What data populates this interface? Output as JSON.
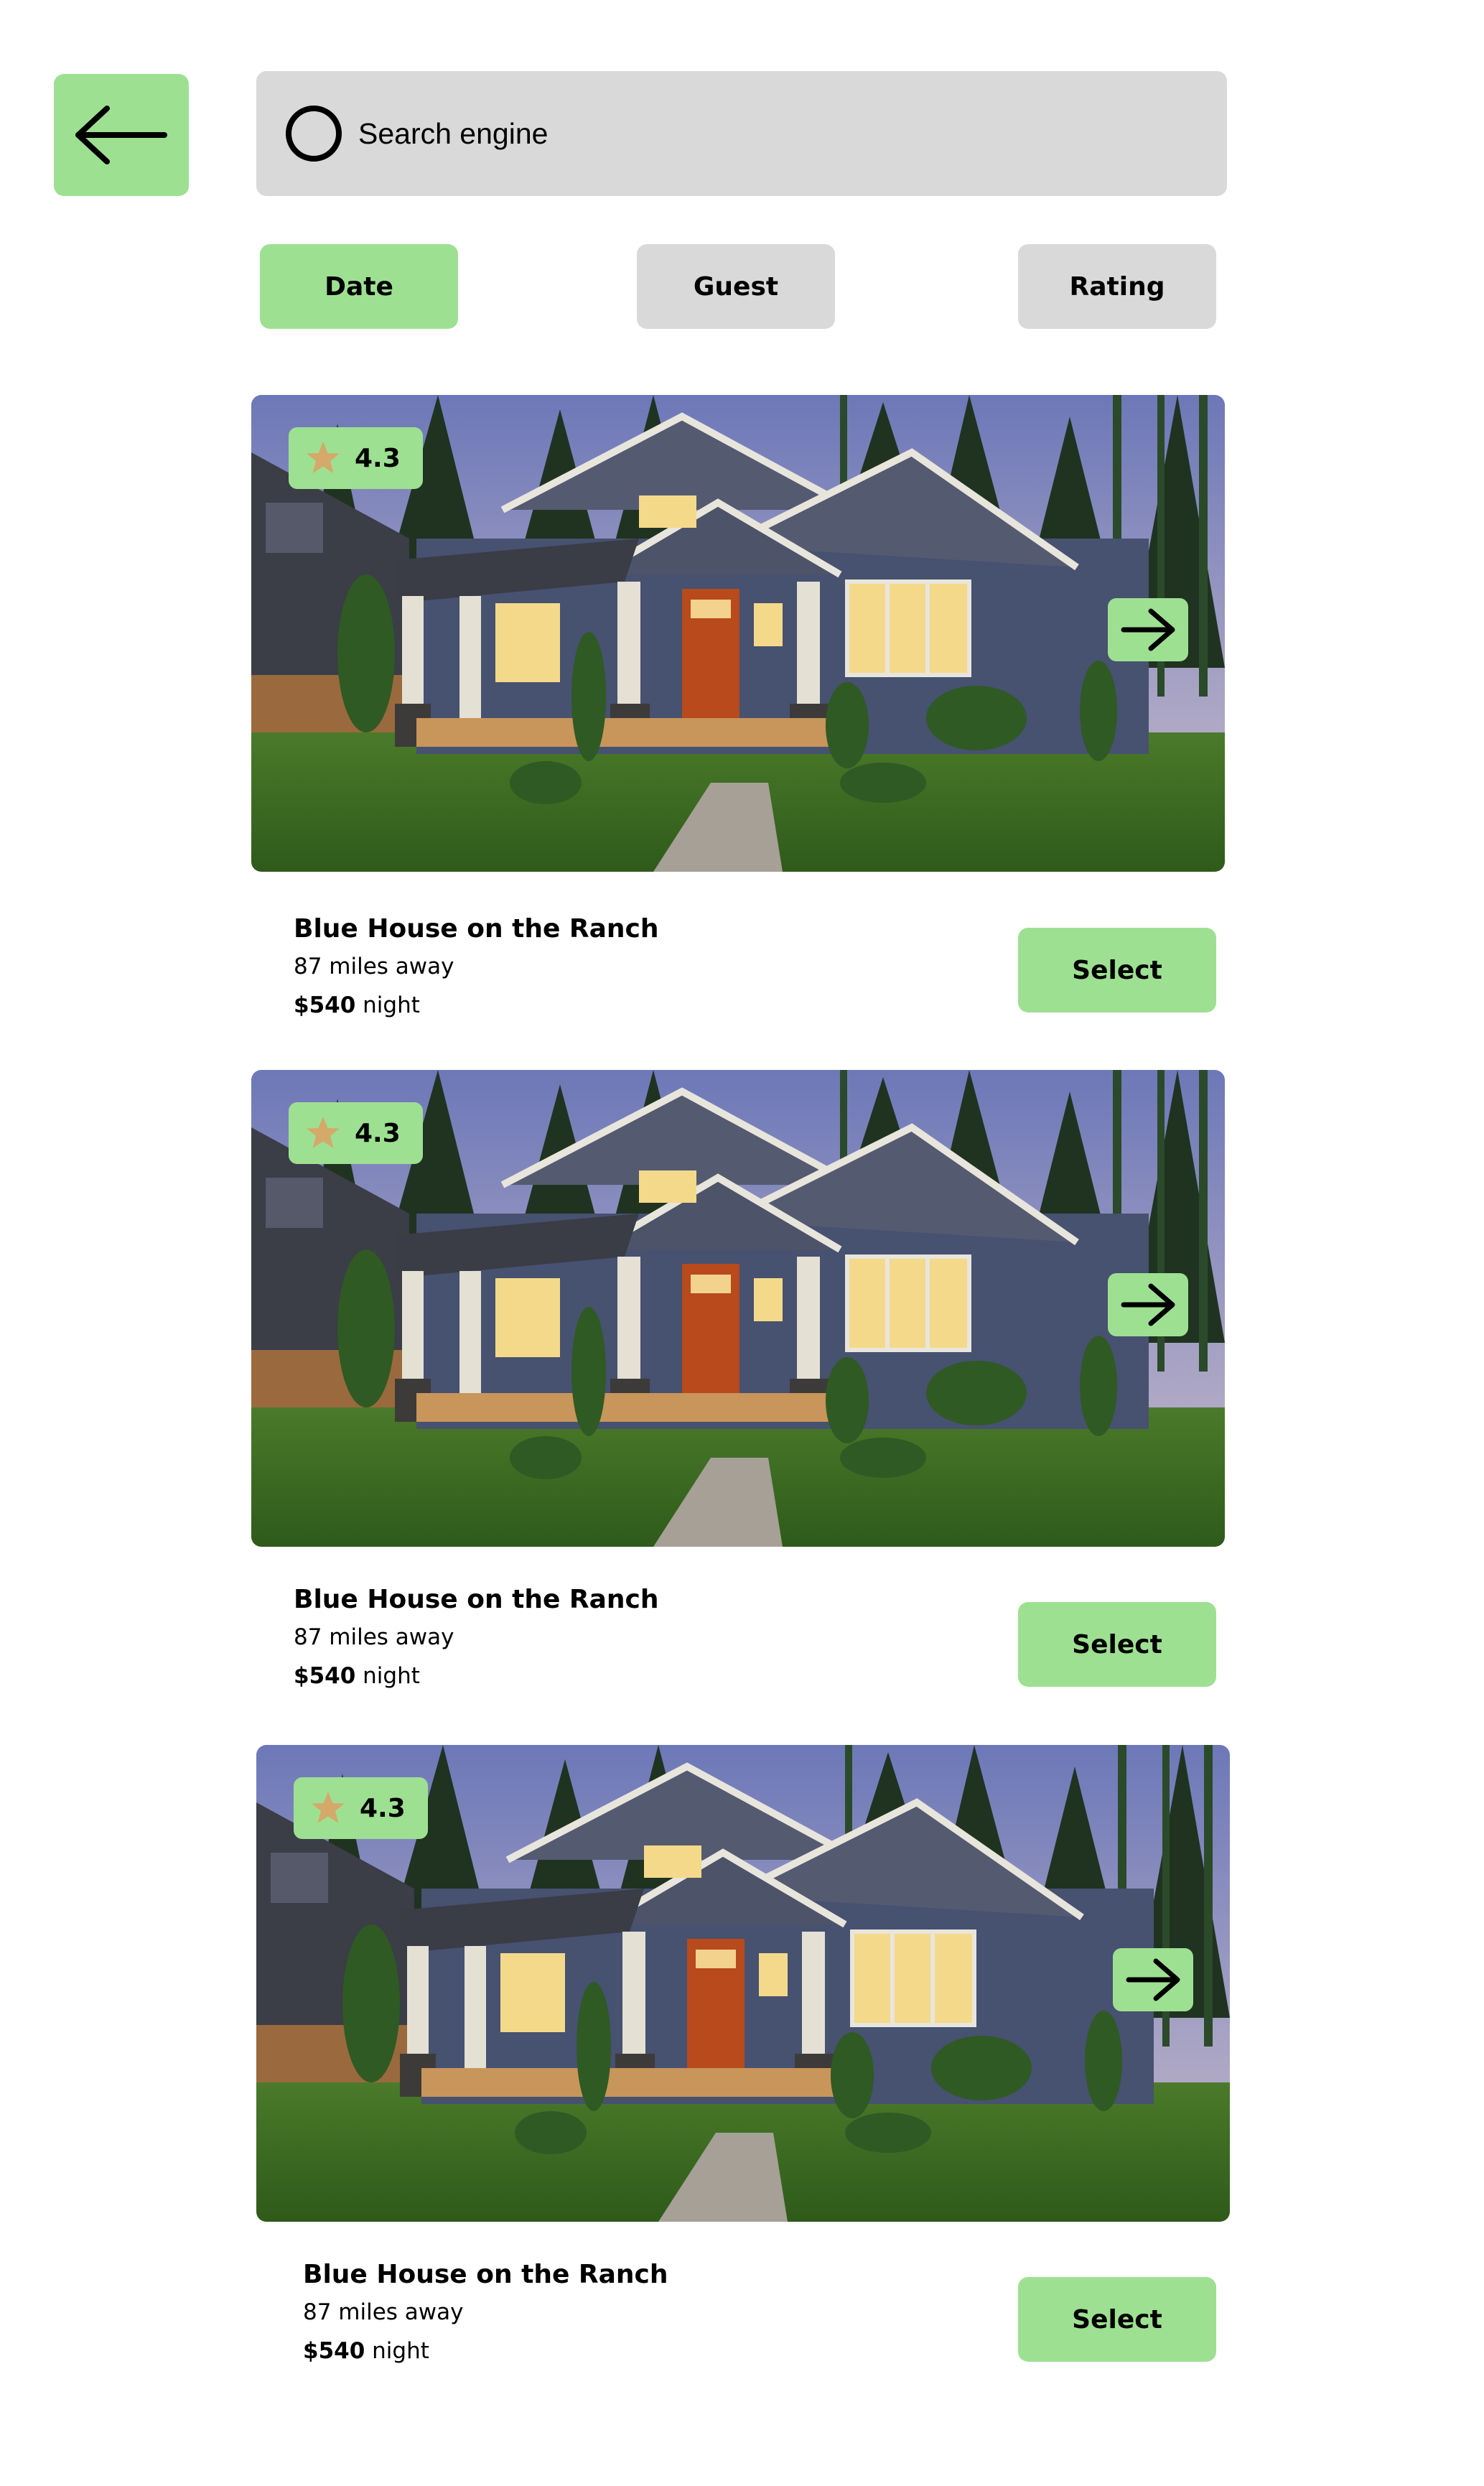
{
  "colors": {
    "accent": "#9ee092",
    "neutral": "#d9d9d9",
    "star": "#d4a96a"
  },
  "nav": {
    "back_icon": "arrow-left-icon"
  },
  "search": {
    "icon": "circle-search-icon",
    "placeholder": "Search engine"
  },
  "filters": [
    {
      "label": "Date",
      "active": true
    },
    {
      "label": "Guest",
      "active": false
    },
    {
      "label": "Rating",
      "active": false
    }
  ],
  "listings": [
    {
      "rating": "4.3",
      "title": "Blue House on the Ranch",
      "distance": "87 miles away",
      "price": "$540",
      "price_unit": " night",
      "select_label": "Select",
      "next_icon": "arrow-right-icon"
    },
    {
      "rating": "4.3",
      "title": "Blue House on the Ranch",
      "distance": "87 miles away",
      "price": "$540",
      "price_unit": " night",
      "select_label": "Select",
      "next_icon": "arrow-right-icon"
    },
    {
      "rating": "4.3",
      "title": "Blue House on the Ranch",
      "distance": "87 miles away",
      "price": "$540",
      "price_unit": " night",
      "select_label": "Select",
      "next_icon": "arrow-right-icon"
    }
  ]
}
